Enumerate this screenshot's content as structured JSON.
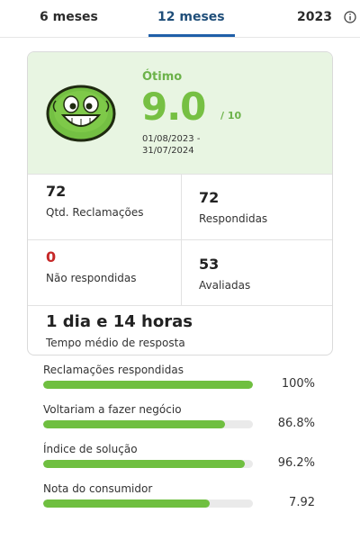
{
  "tabs": {
    "items": [
      "6 meses",
      "12 meses",
      "2023"
    ],
    "active": "12 meses"
  },
  "summary": {
    "rating_label": "Ótimo",
    "score": "9.0",
    "score_max": "/ 10",
    "period": "01/08/2023 - 31/07/2024",
    "face_icon": "smiling-face-icon",
    "accent_color": "#76c043"
  },
  "stats": {
    "complaints": {
      "value": "72",
      "label": "Qtd. Reclamações"
    },
    "answered": {
      "value": "72",
      "label": "Respondidas"
    },
    "unanswered": {
      "value": "0",
      "label": "Não respondidas"
    },
    "rated": {
      "value": "53",
      "label": "Avaliadas"
    }
  },
  "response_time": {
    "value": "1 dia e 14 horas",
    "label": "Tempo médio de resposta"
  },
  "metrics": [
    {
      "label": "Reclamações respondidas",
      "value": "100%",
      "fraction": 1.0
    },
    {
      "label": "Voltariam a fazer negócio",
      "value": "86.8%",
      "fraction": 0.868
    },
    {
      "label": "Índice de solução",
      "value": "96.2%",
      "fraction": 0.962
    },
    {
      "label": "Nota do consumidor",
      "value": "7.92",
      "fraction": 0.792
    }
  ]
}
